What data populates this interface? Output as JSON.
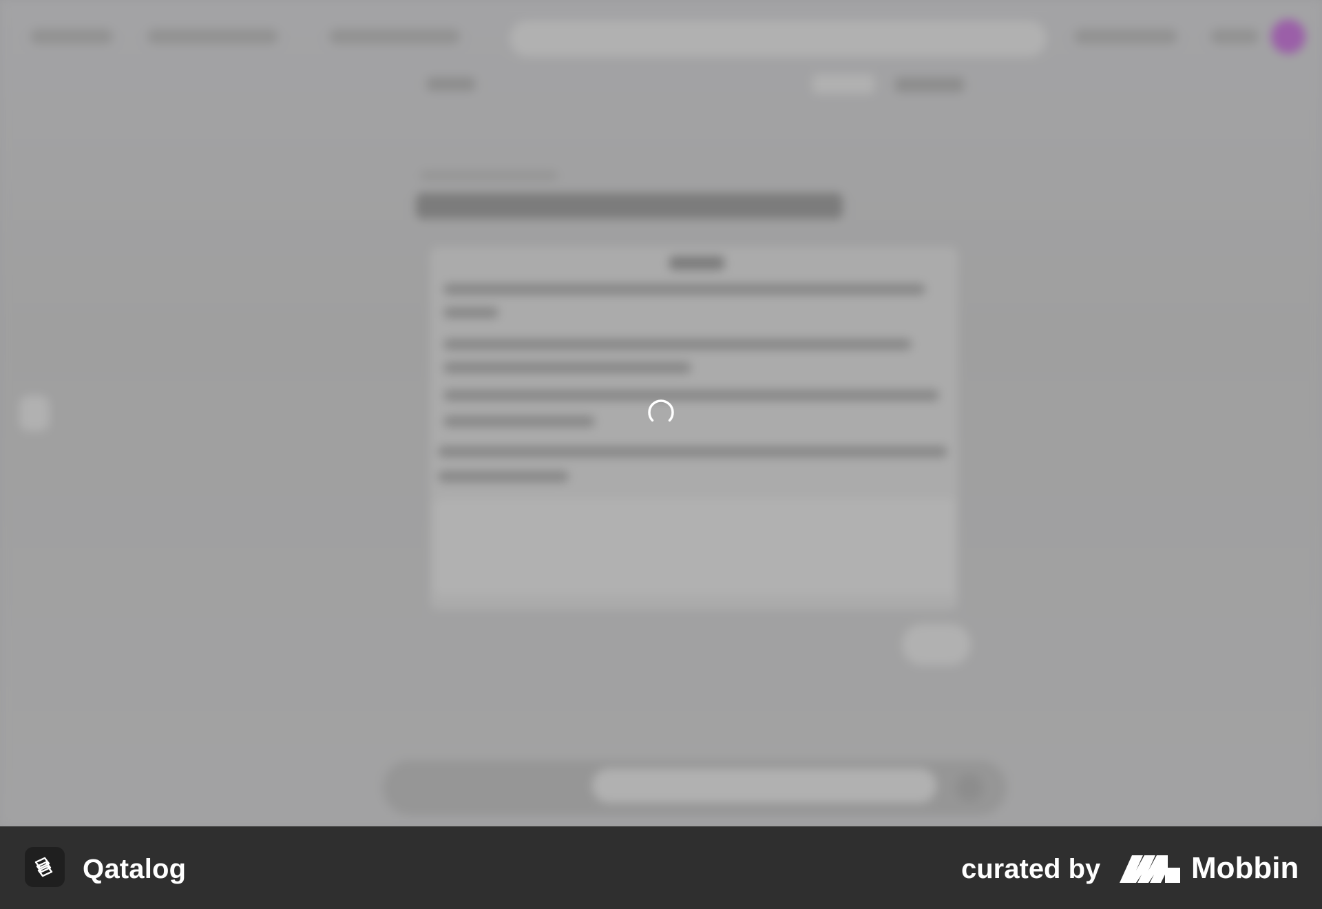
{
  "overlay": {
    "state": "loading"
  },
  "footer": {
    "app_name": "Qatalog",
    "app_icon": "qatalog-logo-icon",
    "curated_label": "curated by",
    "curator_name": "Mobbin",
    "curator_icon": "mobbin-logo-icon",
    "background_color": "#2f2f2f",
    "text_color": "#ffffff"
  },
  "background": {
    "blurred": true,
    "avatar_color": "#9b5fa8"
  }
}
